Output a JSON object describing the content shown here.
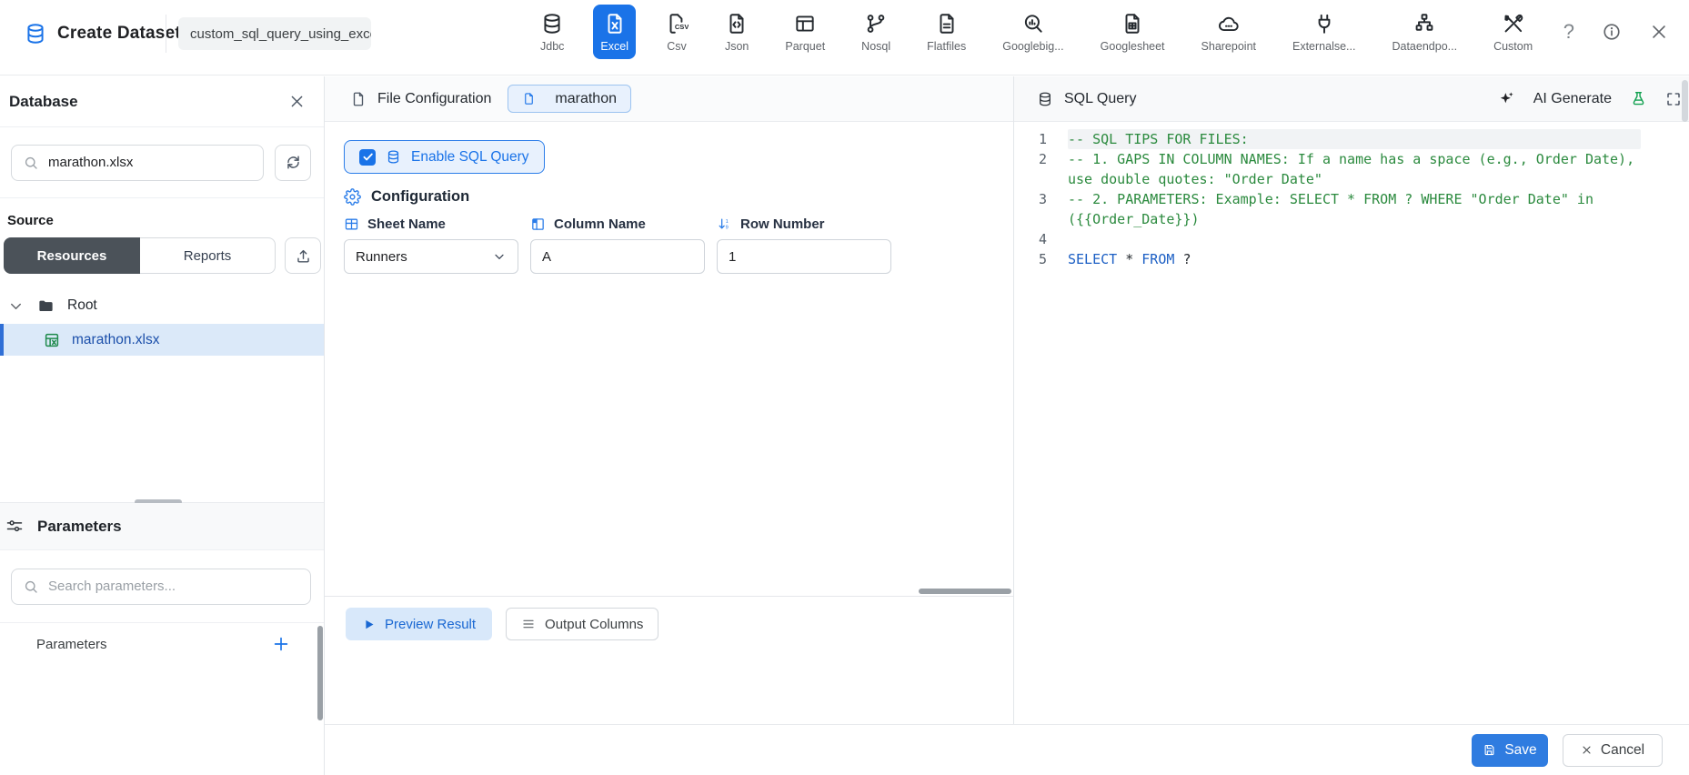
{
  "topbar": {
    "app_title": "Create Dataset",
    "dataset_name": "custom_sql_query_using_exce",
    "sources": [
      {
        "label": "Jdbc",
        "icon": "jdbc-database-icon",
        "selected": false
      },
      {
        "label": "Excel",
        "icon": "excel-file-icon",
        "selected": true
      },
      {
        "label": "Csv",
        "icon": "csv-file-icon",
        "selected": false
      },
      {
        "label": "Json",
        "icon": "json-file-icon",
        "selected": false
      },
      {
        "label": "Parquet",
        "icon": "parquet-table-icon",
        "selected": false
      },
      {
        "label": "Nosql",
        "icon": "nosql-branch-icon",
        "selected": false
      },
      {
        "label": "Flatfiles",
        "icon": "flatfile-doc-icon",
        "selected": false
      },
      {
        "label": "Googlebig...",
        "icon": "bigquery-search-icon",
        "selected": false
      },
      {
        "label": "Googlesheet",
        "icon": "googlesheet-grid-icon",
        "selected": false
      },
      {
        "label": "Sharepoint",
        "icon": "sharepoint-cloud-icon",
        "selected": false
      },
      {
        "label": "Externalse...",
        "icon": "external-plug-icon",
        "selected": false
      },
      {
        "label": "Dataendpo...",
        "icon": "endpoint-sitemap-icon",
        "selected": false
      },
      {
        "label": "Custom",
        "icon": "custom-tools-icon",
        "selected": false
      }
    ],
    "help_label": "?"
  },
  "sidebar": {
    "title": "Database",
    "search_value": "marathon.xlsx",
    "source_label": "Source",
    "tabs": {
      "resources": "Resources",
      "reports": "Reports"
    },
    "tree": {
      "root_label": "Root",
      "file_label": "marathon.xlsx"
    },
    "parameters": {
      "title": "Parameters",
      "search_placeholder": "Search parameters...",
      "list_label": "Parameters",
      "add_label": "+"
    }
  },
  "config": {
    "header_label": "File Configuration",
    "file_tab": "marathon",
    "enable_sql_label": "Enable SQL Query",
    "enable_sql_checked": true,
    "section_title": "Configuration",
    "fields": [
      {
        "label": "Sheet Name",
        "value": "Runners",
        "type": "select",
        "icon": "sheet-table-icon"
      },
      {
        "label": "Column Name",
        "value": "A",
        "type": "text",
        "icon": "column-icon"
      },
      {
        "label": "Row Number",
        "value": "1",
        "type": "text",
        "icon": "sort-rows-icon"
      }
    ],
    "preview_label": "Preview Result",
    "output_label": "Output Columns"
  },
  "sql": {
    "title": "SQL Query",
    "ai_generate_label": "AI Generate",
    "lines": [
      {
        "no": "1",
        "active": true,
        "segments": [
          {
            "t": "comment",
            "text": "-- SQL TIPS FOR FILES:"
          }
        ]
      },
      {
        "no": "2",
        "active": false,
        "segments": [
          {
            "t": "comment",
            "text": "-- 1. GAPS IN COLUMN NAMES: If a name has a space (e.g., Order Date), use double quotes: \"Order Date\""
          }
        ]
      },
      {
        "no": "3",
        "active": false,
        "segments": [
          {
            "t": "comment",
            "text": "-- 2. PARAMETERS: Example: SELECT * FROM ? WHERE \"Order Date\" in ({{Order_Date}})"
          }
        ]
      },
      {
        "no": "4",
        "active": false,
        "segments": []
      },
      {
        "no": "5",
        "active": false,
        "segments": [
          {
            "t": "keyword",
            "text": "SELECT"
          },
          {
            "t": "plain",
            "text": " "
          },
          {
            "t": "operator",
            "text": "*"
          },
          {
            "t": "plain",
            "text": " "
          },
          {
            "t": "keyword",
            "text": "FROM"
          },
          {
            "t": "plain",
            "text": " "
          },
          {
            "t": "param",
            "text": "?"
          }
        ]
      }
    ]
  },
  "footer": {
    "save_label": "Save",
    "cancel_label": "Cancel"
  },
  "colors": {
    "accent_blue": "#1a73e8",
    "selected_row_bg": "#dbe9f9",
    "resources_tab_bg": "#4b5259",
    "comment_green": "#2b8a3e",
    "keyword_blue": "#1c5fc4",
    "save_button_bg": "#2f7ce0"
  }
}
